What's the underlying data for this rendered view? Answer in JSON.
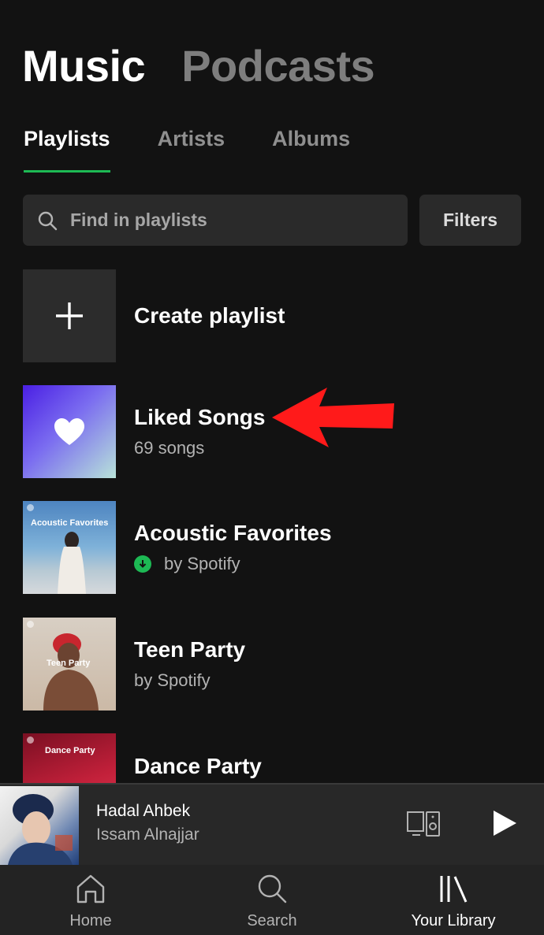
{
  "header": {
    "tabs": [
      {
        "label": "Music",
        "active": true
      },
      {
        "label": "Podcasts",
        "active": false
      }
    ]
  },
  "subtabs": [
    {
      "label": "Playlists",
      "active": true
    },
    {
      "label": "Artists",
      "active": false
    },
    {
      "label": "Albums",
      "active": false
    }
  ],
  "search": {
    "placeholder": "Find in playlists",
    "icon": "search-icon"
  },
  "filters_label": "Filters",
  "playlists": [
    {
      "title": "Create playlist",
      "subtitle": "",
      "icon": "plus-icon"
    },
    {
      "title": "Liked Songs",
      "subtitle": "69 songs",
      "icon": "heart-icon"
    },
    {
      "title": "Acoustic Favorites",
      "subtitle": "by Spotify",
      "downloaded": true,
      "cover_text": "Acoustic Favorites"
    },
    {
      "title": "Teen Party",
      "subtitle": "by Spotify",
      "cover_text": "Teen Party"
    },
    {
      "title": "Dance Party",
      "subtitle": "",
      "cover_text": "Dance Party"
    }
  ],
  "now_playing": {
    "title": "Hadal Ahbek",
    "artist": "Issam Alnajjar"
  },
  "bottom_nav": [
    {
      "label": "Home",
      "icon": "home-icon",
      "active": false
    },
    {
      "label": "Search",
      "icon": "search-icon",
      "active": false
    },
    {
      "label": "Your Library",
      "icon": "library-icon",
      "active": true
    }
  ],
  "colors": {
    "accent": "#1db954",
    "background": "#121212",
    "surface": "#2a2a2a",
    "annotation_arrow": "#ff1a1a"
  }
}
